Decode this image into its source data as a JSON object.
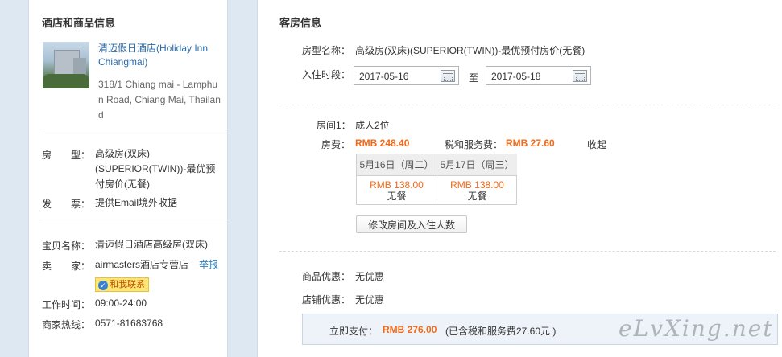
{
  "left": {
    "title": "酒店和商品信息",
    "hotel_name": "清迈假日酒店(Holiday Inn Chiangmai)",
    "hotel_address": "318/1 Chiang mai - Lamphun Road, Chiang Mai, Thailand",
    "room_type_label": "房　　型：",
    "room_type": "高级房(双床)(SUPERIOR(TWIN))-最优预付房价(无餐)",
    "invoice_label": "发　　票：",
    "invoice": "提供Email境外收据",
    "item_name_label": "宝贝名称：",
    "item_name": "清迈假日酒店高级房(双床)",
    "seller_label": "卖　　家：",
    "seller": "airmasters酒店专营店",
    "report_link": "举报",
    "contact_button": "和我联系",
    "hours_label": "工作时间：",
    "hours": "09:00-24:00",
    "hotline_label": "商家热线：",
    "hotline": "0571-81683768"
  },
  "right": {
    "title": "客房信息",
    "room_type_label": "房型名称：",
    "room_type": "高级房(双床)(SUPERIOR(TWIN))-最优预付房价(无餐)",
    "stay_label": "入住时段：",
    "checkin": "2017-05-16",
    "to": "至",
    "checkout": "2017-05-18",
    "room1_label": "房间1：",
    "room1_guests": "成人2位",
    "room_fee_label": "房费：",
    "room_fee": "RMB 248.40",
    "tax_label": "税和服务费：",
    "tax": "RMB 27.60",
    "collapse_link": "收起",
    "days": [
      {
        "date": "5月16日（周二）",
        "price": "RMB 138.00",
        "meal": "无餐"
      },
      {
        "date": "5月17日（周三）",
        "price": "RMB 138.00",
        "meal": "无餐"
      }
    ],
    "modify_button": "修改房间及入住人数",
    "product_discount_label": "商品优惠：",
    "product_discount": "无优惠",
    "shop_discount_label": "店铺优惠：",
    "shop_discount": "无优惠",
    "pay_label": "立即支付：",
    "pay_amount": "RMB 276.00",
    "pay_note": "(已含税和服务费27.60元 )"
  },
  "watermark": "eLvXing.net"
}
